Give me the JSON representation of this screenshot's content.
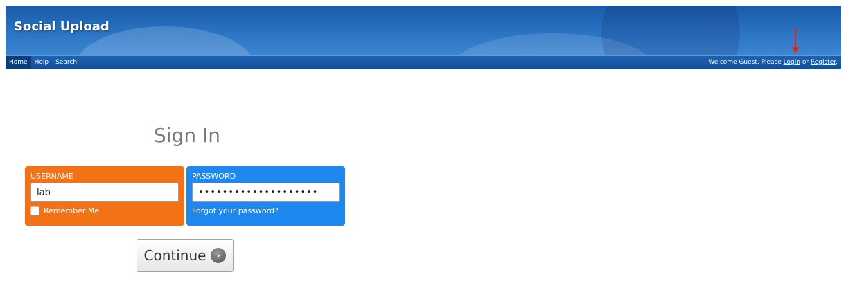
{
  "brand": "Social Upload",
  "nav": {
    "home": "Home",
    "help": "Help",
    "search": "Search"
  },
  "welcome": {
    "prefix": "Welcome Guest. Please ",
    "login": "Login",
    "middle": " or ",
    "register": "Register",
    "suffix": "."
  },
  "signin": {
    "title": "Sign In",
    "username_label": "USERNAME",
    "username_value": "lab",
    "remember_label": "Remember Me",
    "password_label": "PASSWORD",
    "password_value": "••••••••••••••••••••",
    "forgot_label": "Forgot your password?",
    "continue_label": "Continue"
  },
  "icons": {
    "continue_icon": "arrow-right-circle-icon",
    "annotation": "red-arrow-icon"
  },
  "colors": {
    "username_panel": "#f47216",
    "password_panel": "#1e88f0",
    "banner": "#1a5aa8",
    "annotation_arrow": "#e02020"
  }
}
